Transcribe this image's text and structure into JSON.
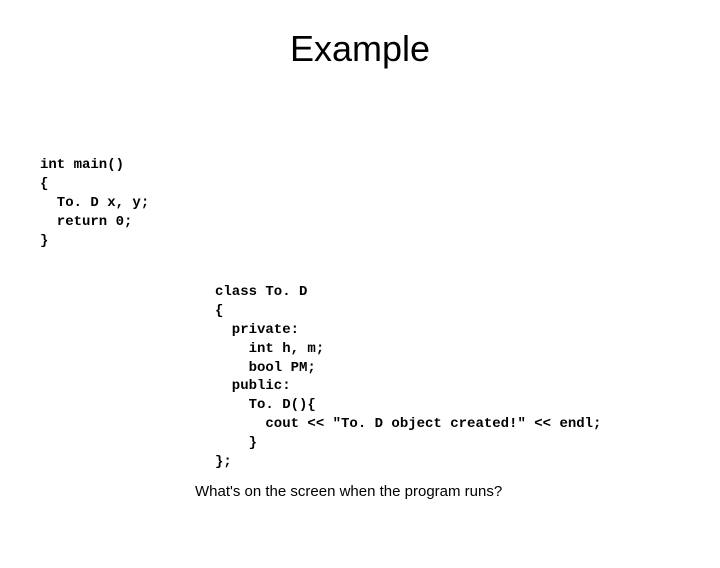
{
  "title": "Example",
  "code1": "int main()\n{\n  To. D x, y;\n  return 0;\n}",
  "code2": "class To. D\n{\n  private:\n    int h, m;\n    bool PM;\n  public:\n    To. D(){\n      cout << \"To. D object created!\" << endl;\n    }\n};",
  "question": "What's on the screen when the program runs?"
}
